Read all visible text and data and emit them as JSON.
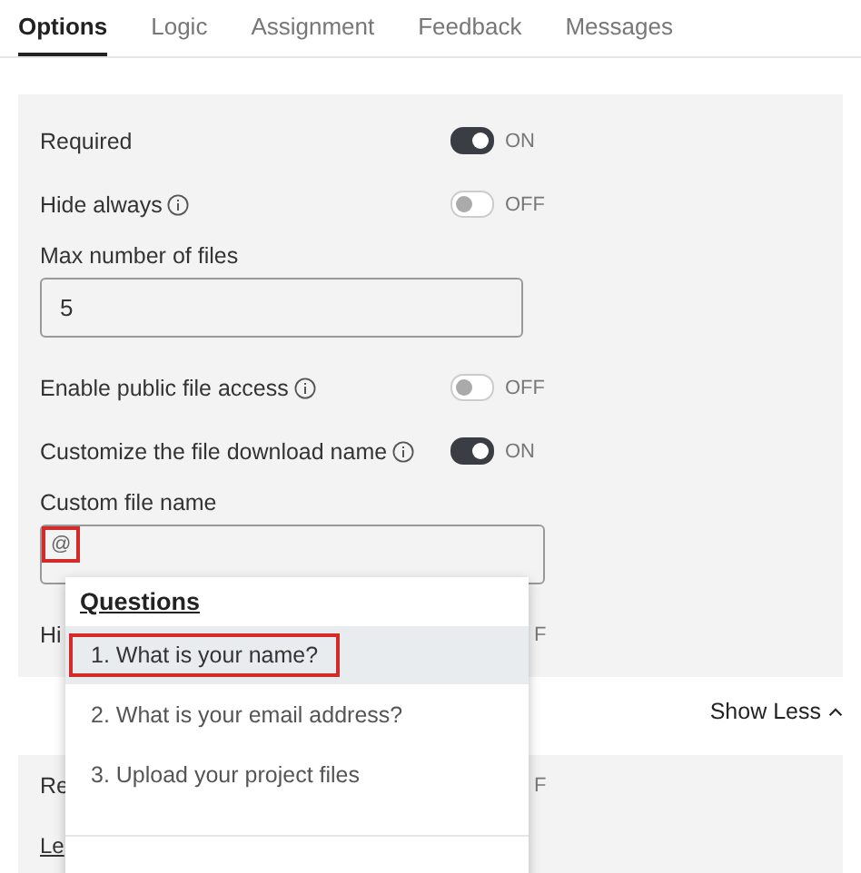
{
  "tabs": [
    {
      "label": "Options",
      "selected": true
    },
    {
      "label": "Logic",
      "selected": false
    },
    {
      "label": "Assignment",
      "selected": false
    },
    {
      "label": "Feedback",
      "selected": false
    },
    {
      "label": "Messages",
      "selected": false
    }
  ],
  "options": [
    {
      "kind": "toggle",
      "label": "Required",
      "info": false,
      "on": true,
      "state": "ON"
    },
    {
      "kind": "toggle",
      "label": "Hide always",
      "info": true,
      "on": false,
      "state": "OFF"
    },
    {
      "kind": "field",
      "label": "Max number of files",
      "value": "5",
      "highlighted": false
    },
    {
      "kind": "toggle",
      "label": "Enable public file access",
      "info": true,
      "on": false,
      "state": "OFF"
    },
    {
      "kind": "toggle",
      "label": "Customize the file download name",
      "info": true,
      "on": true,
      "state": "ON"
    },
    {
      "kind": "field",
      "label": "Custom file name",
      "value": "@",
      "highlighted": true
    },
    {
      "kind": "partial",
      "label": "Hi",
      "state": "F"
    }
  ],
  "show_less": "Show Less",
  "more_options": [
    {
      "kind": "partial",
      "label": "Re",
      "state": "F"
    },
    {
      "kind": "link",
      "label": "Le"
    }
  ],
  "popup": {
    "heading": "Questions",
    "items": [
      {
        "label": "1. What is your name?",
        "selected": true,
        "highlighted": true
      },
      {
        "label": "2. What is your email address?",
        "selected": false,
        "highlighted": false
      },
      {
        "label": "3. Upload your project files",
        "selected": false,
        "highlighted": false
      }
    ]
  }
}
